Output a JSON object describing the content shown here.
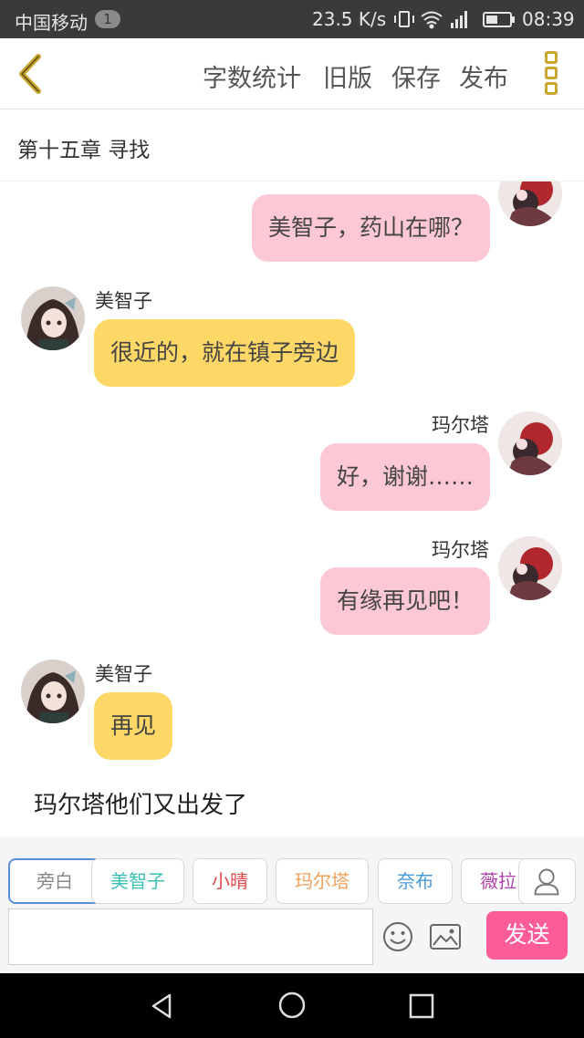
{
  "status_bar": {
    "carrier": "中国移动",
    "notification_count": "1",
    "net_speed": "23.5 K/s",
    "time": "08:39"
  },
  "header": {
    "back_icon": "chevron-left-icon",
    "word_count_label": "字数统计",
    "old_version_label": "旧版",
    "save_label": "保存",
    "publish_label": "发布",
    "menu_icon": "more-vertical-icon",
    "accent_color": "#c8a630"
  },
  "chapter": {
    "title": "第十五章  寻找"
  },
  "messages": [
    {
      "speaker": "",
      "text": "美智子，药山在哪？",
      "side": "right",
      "color": "#fbc8d4"
    },
    {
      "speaker": "美智子",
      "text": "很近的，就在镇子旁边",
      "side": "left",
      "color": "#fed867"
    },
    {
      "speaker": "玛尔塔",
      "text": "好，谢谢……",
      "side": "right",
      "color": "#fbc8d4"
    },
    {
      "speaker": "玛尔塔",
      "text": "有缘再见吧！",
      "side": "right",
      "color": "#fbc8d4"
    },
    {
      "speaker": "美智子",
      "text": "再见",
      "side": "left",
      "color": "#fed867"
    }
  ],
  "narration": "玛尔塔他们又出发了",
  "roles": [
    {
      "label": "旁白",
      "color": "#888888",
      "active": true
    },
    {
      "label": "美智子",
      "color": "#3bbfb3"
    },
    {
      "label": "小晴",
      "color": "#e14a4a"
    },
    {
      "label": "玛尔塔",
      "color": "#f0a25c"
    },
    {
      "label": "奈布",
      "color": "#4a9ad8"
    },
    {
      "label": "薇拉",
      "color": "#b044a8"
    }
  ],
  "composer": {
    "input_value": "",
    "send_label": "发送",
    "send_color": "#fc5d99",
    "icons": [
      "person-icon",
      "emoji-icon",
      "image-icon"
    ]
  },
  "nav_bar": {
    "icons": [
      "back-triangle-icon",
      "home-circle-icon",
      "recent-square-icon"
    ]
  }
}
